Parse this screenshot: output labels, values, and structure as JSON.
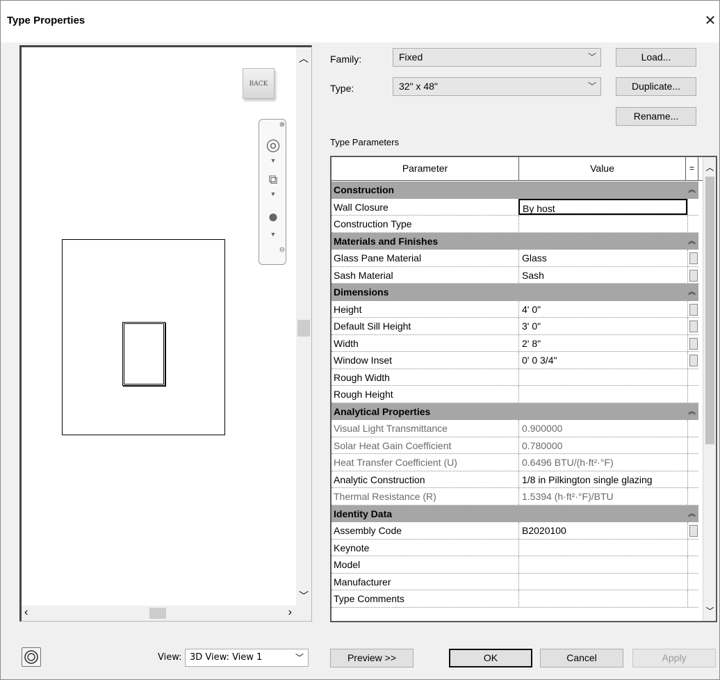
{
  "dialog": {
    "title": "Type Properties"
  },
  "family": {
    "label": "Family:",
    "value": "Fixed"
  },
  "type": {
    "label": "Type:",
    "value": "32\" x 48\""
  },
  "buttons": {
    "load": "Load...",
    "duplicate": "Duplicate...",
    "rename": "Rename...",
    "preview": "Preview >>",
    "ok": "OK",
    "cancel": "Cancel",
    "apply": "Apply"
  },
  "preview": {
    "viewcube_label": "BACK",
    "view_label": "View:",
    "view_value": "3D View: View 1"
  },
  "type_parameters": {
    "title": "Type Parameters",
    "headers": {
      "parameter": "Parameter",
      "value": "Value",
      "toggle": "="
    },
    "rows": [
      {
        "kind": "group",
        "name": "Construction"
      },
      {
        "kind": "row",
        "name": "Wall Closure",
        "value": "By host",
        "editing": true
      },
      {
        "kind": "row",
        "name": "Construction Type",
        "value": ""
      },
      {
        "kind": "group",
        "name": "Materials and Finishes"
      },
      {
        "kind": "row",
        "name": "Glass Pane Material",
        "value": "Glass",
        "assoc": true
      },
      {
        "kind": "row",
        "name": "Sash Material",
        "value": "Sash",
        "assoc": true
      },
      {
        "kind": "group",
        "name": "Dimensions"
      },
      {
        "kind": "row",
        "name": "Height",
        "value": "4'  0\"",
        "assoc": true
      },
      {
        "kind": "row",
        "name": "Default Sill Height",
        "value": "3'  0\"",
        "assoc": true
      },
      {
        "kind": "row",
        "name": "Width",
        "value": "2'  8\"",
        "assoc": true
      },
      {
        "kind": "row",
        "name": "Window Inset",
        "value": "0'  0 3/4\"",
        "assoc": true
      },
      {
        "kind": "row",
        "name": "Rough Width",
        "value": ""
      },
      {
        "kind": "row",
        "name": "Rough Height",
        "value": ""
      },
      {
        "kind": "group",
        "name": "Analytical Properties"
      },
      {
        "kind": "row",
        "name": "Visual Light Transmittance",
        "value": "0.900000",
        "grey": true
      },
      {
        "kind": "row",
        "name": "Solar Heat Gain Coefficient",
        "value": "0.780000",
        "grey": true
      },
      {
        "kind": "row",
        "name": "Heat Transfer Coefficient (U)",
        "value": "0.6496 BTU/(h·ft²·°F)",
        "grey": true
      },
      {
        "kind": "row",
        "name": "Analytic Construction",
        "value": "1/8 in Pilkington single glazing"
      },
      {
        "kind": "row",
        "name": "Thermal Resistance (R)",
        "value": "1.5394 (h·ft²·°F)/BTU",
        "grey": true
      },
      {
        "kind": "group",
        "name": "Identity Data"
      },
      {
        "kind": "row",
        "name": "Assembly Code",
        "value": "B2020100",
        "assoc": true
      },
      {
        "kind": "row",
        "name": "Keynote",
        "value": ""
      },
      {
        "kind": "row",
        "name": "Model",
        "value": ""
      },
      {
        "kind": "row",
        "name": "Manufacturer",
        "value": ""
      },
      {
        "kind": "row",
        "name": "Type Comments",
        "value": ""
      }
    ]
  },
  "icons": {
    "close": "close-icon",
    "collapse": "collapse-caret-icon",
    "dropdown": "chevron-down-icon"
  }
}
